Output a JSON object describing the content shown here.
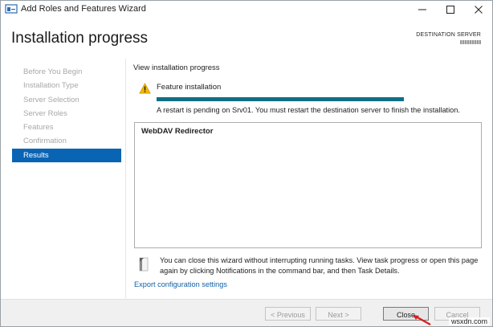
{
  "window": {
    "title": "Add Roles and Features Wizard"
  },
  "header": {
    "page_title": "Installation progress",
    "destination_label": "DESTINATION SERVER"
  },
  "nav": {
    "items": [
      {
        "label": "Before You Begin"
      },
      {
        "label": "Installation Type"
      },
      {
        "label": "Server Selection"
      },
      {
        "label": "Server Roles"
      },
      {
        "label": "Features"
      },
      {
        "label": "Confirmation"
      },
      {
        "label": "Results"
      }
    ],
    "active_index": 6
  },
  "content": {
    "section_title": "View installation progress",
    "feature_installation_label": "Feature installation",
    "progress_fraction": 1.0,
    "restart_message": "A restart is pending on Srv01. You must restart the destination server to finish the installation.",
    "results_items": [
      "WebDAV Redirector"
    ],
    "info_message": "You can close this wizard without interrupting running tasks. View task progress or open this page again by clicking Notifications in the command bar, and then Task Details.",
    "export_link": "Export configuration settings"
  },
  "footer": {
    "previous_label": "< Previous",
    "next_label": "Next >",
    "close_label": "Close",
    "cancel_label": "Cancel"
  },
  "watermark": "wsxdn.com",
  "colors": {
    "accent": "#0a64b4",
    "progress": "#0f6f85",
    "link": "#1060a8",
    "warning": "#f2b600"
  }
}
